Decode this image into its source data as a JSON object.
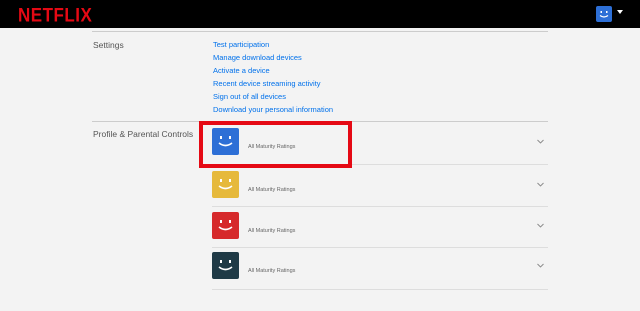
{
  "header": {
    "logo_text": "NETFLIX",
    "avatar_color": "#2d6fd6",
    "brand_color": "#e50914"
  },
  "settings": {
    "title": "Settings",
    "links": [
      "Test participation",
      "Manage download devices",
      "Activate a device",
      "Recent device streaming activity",
      "Sign out of all devices",
      "Download your personal information"
    ],
    "link_color": "#0071eb"
  },
  "profiles": {
    "title": "Profile & Parental Controls",
    "items": [
      {
        "rating": "All Maturity Ratings",
        "color": "#2d6fd6",
        "icon": "smiley-face-icon"
      },
      {
        "rating": "All Maturity Ratings",
        "color": "#e6b93b",
        "icon": "smiley-face-icon"
      },
      {
        "rating": "All Maturity Ratings",
        "color": "#d6292b",
        "icon": "smiley-face-icon"
      },
      {
        "rating": "All Maturity Ratings",
        "color": "#1f3a46",
        "icon": "smiley-face-icon"
      }
    ]
  },
  "highlight": {
    "color": "#e50914",
    "target": "profile-row-1"
  }
}
